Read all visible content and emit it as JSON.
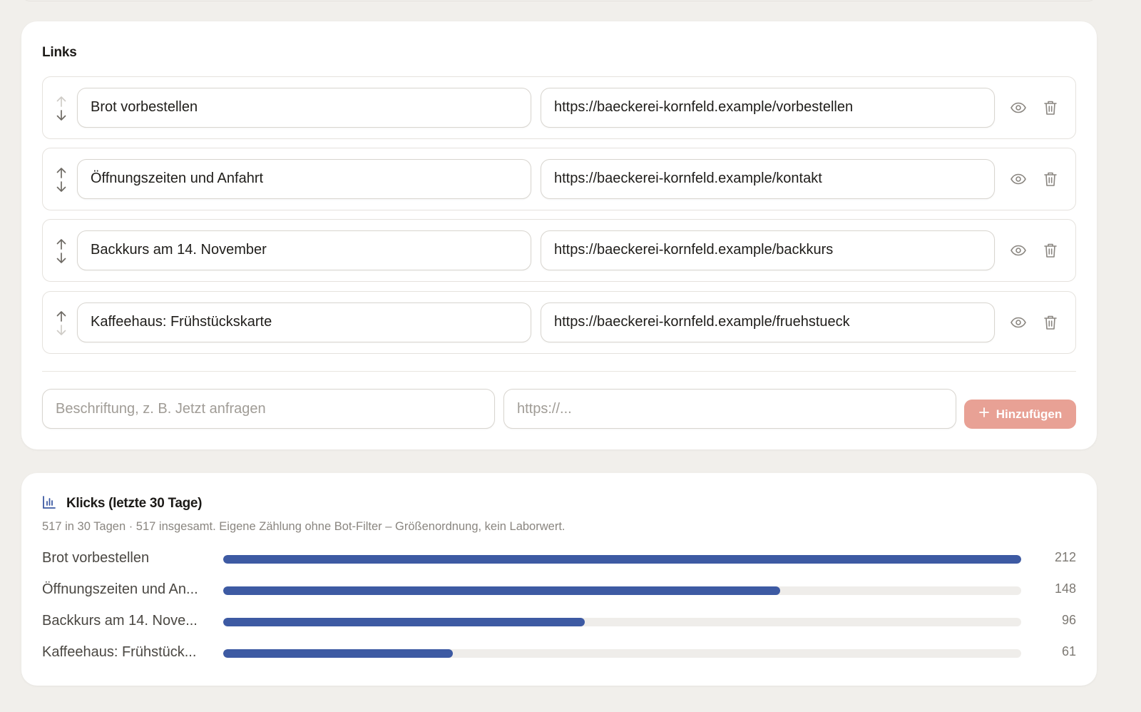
{
  "links_section": {
    "title": "Links",
    "rows": [
      {
        "label": "Brot vorbestellen",
        "url": "https://baeckerei-kornfeld.example/vorbestellen",
        "up_enabled": false,
        "down_enabled": true
      },
      {
        "label": "Öffnungszeiten und Anfahrt",
        "url": "https://baeckerei-kornfeld.example/kontakt",
        "up_enabled": true,
        "down_enabled": true
      },
      {
        "label": "Backkurs am 14. November",
        "url": "https://baeckerei-kornfeld.example/backkurs",
        "up_enabled": true,
        "down_enabled": true
      },
      {
        "label": "Kaffeehaus: Frühstückskarte",
        "url": "https://baeckerei-kornfeld.example/fruehstueck",
        "up_enabled": true,
        "down_enabled": false
      }
    ],
    "row_icons": [
      "arrow-up-icon",
      "arrow-down-icon",
      "eye-icon",
      "trash-icon"
    ],
    "new_link": {
      "label_placeholder": "Beschriftung, z. B. Jetzt anfragen",
      "url_placeholder": "https://...",
      "add_button_label": "Hinzufügen",
      "add_button_icon": "plus-icon",
      "add_button_color": "#e8a195"
    }
  },
  "clicks_section": {
    "icon": "bar-chart-icon",
    "title": "Klicks (letzte 30 Tage)",
    "subtitle": "517 in 30 Tagen · 517 insgesamt. Eigene Zählung ohne Bot-Filter – Größenordnung, kein Laborwert.",
    "bar_color": "#3d5aa3",
    "track_color": "#efedea"
  },
  "chart_data": {
    "type": "bar",
    "orientation": "horizontal",
    "categories": [
      "Brot vorbestellen",
      "Öffnungszeiten und An...",
      "Backkurs am 14. Nove...",
      "Kaffeehaus: Frühstück..."
    ],
    "values": [
      212,
      148,
      96,
      61
    ],
    "max": 212
  }
}
